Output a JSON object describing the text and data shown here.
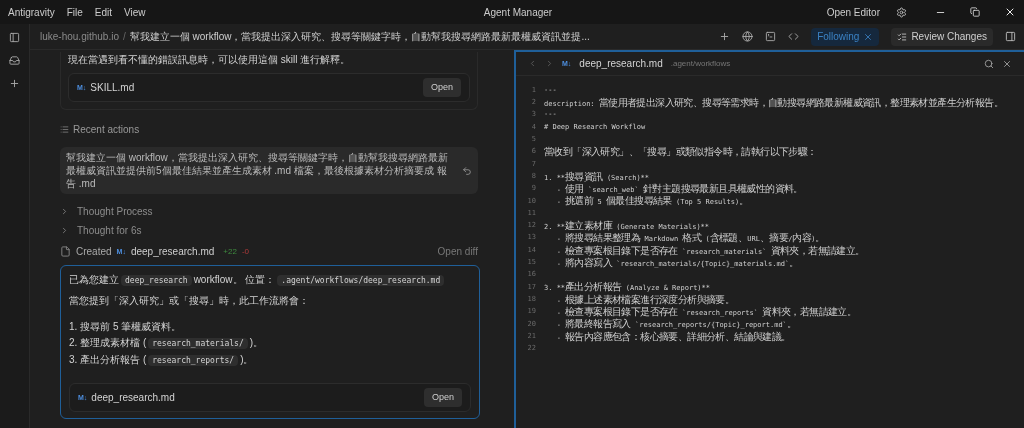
{
  "titlebar": {
    "menu": [
      "Antigravity",
      "File",
      "Edit",
      "View"
    ],
    "title": "Agent Manager",
    "open_editor": "Open Editor"
  },
  "breadcrumb": {
    "repo": "luke-hou.github.io",
    "separator": "/",
    "task": "幫我建立一個 workflow，當我提出深入研究、搜尋等關鍵字時，自動幫我搜尋網路最新最權威資訊並提..."
  },
  "toolbar": {
    "following": {
      "label": "Following",
      "selected": true
    },
    "review": "Review Changes"
  },
  "chat": {
    "prev_text": "現在當遇到看不懂的錯誤訊息時，可以使用這個 skill 進行解釋。",
    "prev_file": {
      "badge": "M↓",
      "name": "SKILL.md",
      "button": "Open"
    },
    "recent_actions": "Recent actions",
    "request": "幫我建立一個 workflow，當我提出深入研究、搜尋等關鍵字時，自動幫我搜尋網路最新最權威資訊並提供前5個最佳結果並產生成素材 .md 檔案，最後根據素材分析摘要成 報告 .md",
    "thoughts": [
      {
        "label": "Thought Process",
        "expanded": false
      },
      {
        "label": "Thought for 6s",
        "expanded": false
      }
    ],
    "created": {
      "label": "Created",
      "badge": "M↓",
      "file": "deep_research.md",
      "added": "+22",
      "removed": "-0",
      "diff": "Open diff"
    },
    "response": {
      "paragraphs": [
        [
          {
            "kind": "text",
            "text": "已為您建立"
          },
          {
            "kind": "code",
            "text": "deep_research"
          },
          {
            "kind": "text",
            "text": "workflow。 位置："
          },
          {
            "kind": "code",
            "text": ".agent/workflows/deep_research.md"
          }
        ],
        [
          {
            "kind": "text",
            "text": "當您提到「深入研究」或「搜尋」時，此工作流將會："
          }
        ]
      ],
      "list": [
        [
          {
            "kind": "text",
            "text": "1. 搜尋前 5 筆權威資料。"
          }
        ],
        [
          {
            "kind": "text",
            "text": "2. 整理成素材檔 ("
          },
          {
            "kind": "code",
            "text": "research_materials/"
          },
          {
            "kind": "text",
            "text": ")。"
          }
        ],
        [
          {
            "kind": "text",
            "text": "3. 產出分析報告 ("
          },
          {
            "kind": "code",
            "text": "research_reports/"
          },
          {
            "kind": "text",
            "text": ")。"
          }
        ]
      ],
      "file": {
        "badge": "M↓",
        "name": "deep_research.md",
        "button": "Open"
      }
    }
  },
  "editor": {
    "badge": "M↓",
    "file": "deep_research.md",
    "path": ".agent/workflows",
    "lines": [
      {
        "n": "1",
        "text": "---"
      },
      {
        "n": "2",
        "text": "description: 當使用者提出深入研究、搜尋等需求時，自動搜尋網路最新權威資訊，整理素材並產生分析報告。"
      },
      {
        "n": "3",
        "text": "---"
      },
      {
        "n": "4",
        "text": "# Deep Research Workflow"
      },
      {
        "n": "5"
      },
      {
        "n": "6",
        "text": "當收到「深入研究」、「搜尋」或類似指令時，請執行以下步驟："
      },
      {
        "n": "7"
      },
      {
        "n": "8",
        "text": "1. **搜尋資訊 (Search)**"
      },
      {
        "n": "9",
        "text": "   - 使用 `search_web` 針對主題搜尋最新且具權威性的資料。"
      },
      {
        "n": "10",
        "text": "   - 挑選前 5 個最佳搜尋結果 (Top 5 Results)。"
      },
      {
        "n": "11"
      },
      {
        "n": "12",
        "text": "2. **建立素材庫 (Generate Materials)**"
      },
      {
        "n": "13",
        "text": "   - 將搜尋結果整理為 Markdown 格式 (含標題、URL、摘要/內容)。"
      },
      {
        "n": "14",
        "text": "   - 檢查專案根目錄下是否存在 `research_materials` 資料夾，若無請建立。"
      },
      {
        "n": "15",
        "text": "   - 將內容寫入 `research_materials/{Topic}_materials.md`。"
      },
      {
        "n": "16"
      },
      {
        "n": "17",
        "text": "3. **產出分析報告 (Analyze & Report)**"
      },
      {
        "n": "18",
        "text": "   - 根據上述素材檔案進行深度分析與摘要。"
      },
      {
        "n": "19",
        "text": "   - 檢查專案根目錄下是否存在 `research_reports` 資料夾，若無請建立。"
      },
      {
        "n": "20",
        "text": "   - 將最終報告寫入 `research_reports/{Topic}_report.md`。"
      },
      {
        "n": "21",
        "text": "   - 報告內容應包含：核心摘要、詳細分析、結論與建議。"
      },
      {
        "n": "22"
      }
    ]
  }
}
